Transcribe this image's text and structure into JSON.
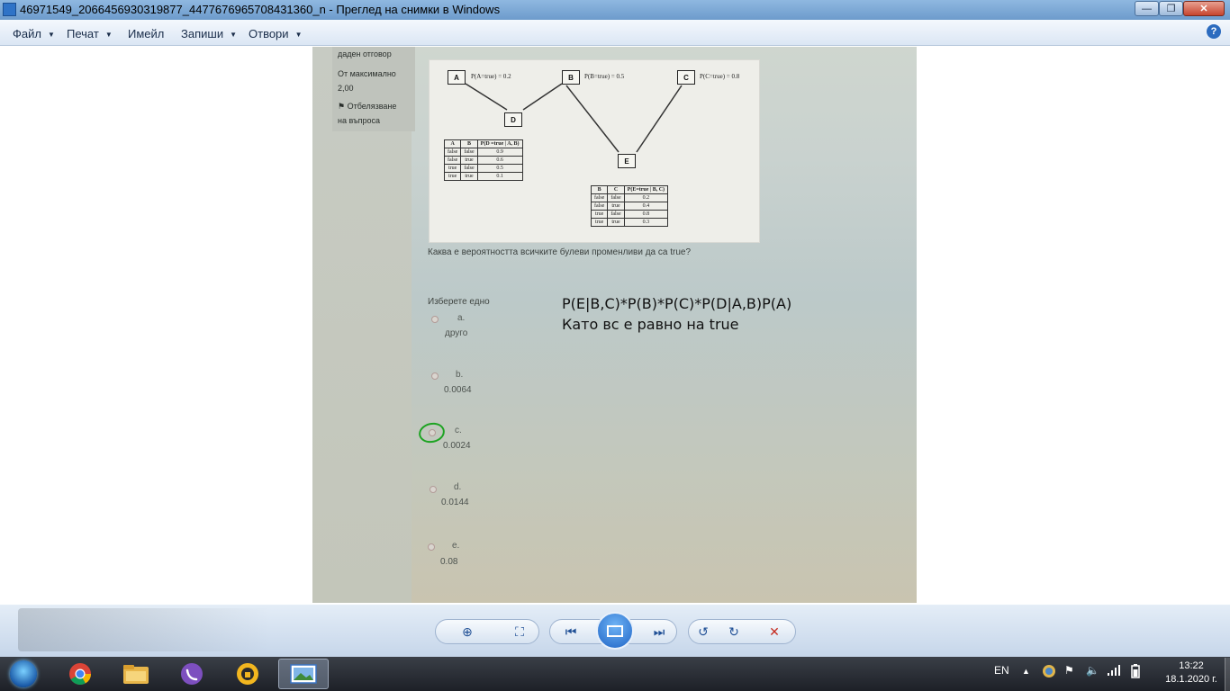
{
  "window": {
    "title": "46971549_2066456930319877_4477676965708431360_n - Преглед на снимки в Windows",
    "minimize_label": "—",
    "maximize_label": "❐",
    "close_label": "✕"
  },
  "menu": {
    "items": [
      {
        "label": "Файл",
        "has_dropdown": true
      },
      {
        "label": "Печат",
        "has_dropdown": true
      },
      {
        "label": "Имейл",
        "has_dropdown": false
      },
      {
        "label": "Запиши",
        "has_dropdown": true
      },
      {
        "label": "Отвори",
        "has_dropdown": true
      }
    ],
    "help_label": "?"
  },
  "photo": {
    "sidebar": {
      "line1": "даден отговор",
      "line2": "От максимално",
      "line3": "2,00",
      "flag_line1": "Отбелязване",
      "flag_line2": "на въпроса"
    },
    "diagram": {
      "nodes": {
        "a": "A",
        "b": "B",
        "c": "C",
        "d": "D",
        "e": "E"
      },
      "prior_a": "P(A=true) = 0.2",
      "prior_b": "P(B=true) = 0.5",
      "prior_c": "P(C=true) = 0.8",
      "cpt_d": {
        "headers": [
          "A",
          "B",
          "P(D =true | A, B)"
        ],
        "rows": [
          [
            "false",
            "false",
            "0.9"
          ],
          [
            "false",
            "true",
            "0.6"
          ],
          [
            "true",
            "false",
            "0.5"
          ],
          [
            "true",
            "true",
            "0.1"
          ]
        ]
      },
      "cpt_e": {
        "headers": [
          "B",
          "C",
          "P(E=true | B, C)"
        ],
        "rows": [
          [
            "false",
            "false",
            "0.2"
          ],
          [
            "false",
            "true",
            "0.4"
          ],
          [
            "true",
            "false",
            "0.8"
          ],
          [
            "true",
            "true",
            "0.3"
          ]
        ]
      }
    },
    "question": "Каква е вероятността всичките булеви променливи да са true?",
    "choose_label": "Изберете едно",
    "options": [
      {
        "letter": "a.",
        "value": "друго"
      },
      {
        "letter": "b.",
        "value": "0.0064"
      },
      {
        "letter": "c.",
        "value": "0.0024"
      },
      {
        "letter": "d.",
        "value": "0.0144"
      },
      {
        "letter": "e.",
        "value": "0.08"
      }
    ],
    "annotation": {
      "line1": "P(E|B,C)*P(B)*P(C)*P(D|A,B)P(A)",
      "line2": "Като вс е равно на true"
    }
  },
  "taskbar": {
    "language": "EN",
    "time": "13:22",
    "date": "18.1.2020 г."
  }
}
